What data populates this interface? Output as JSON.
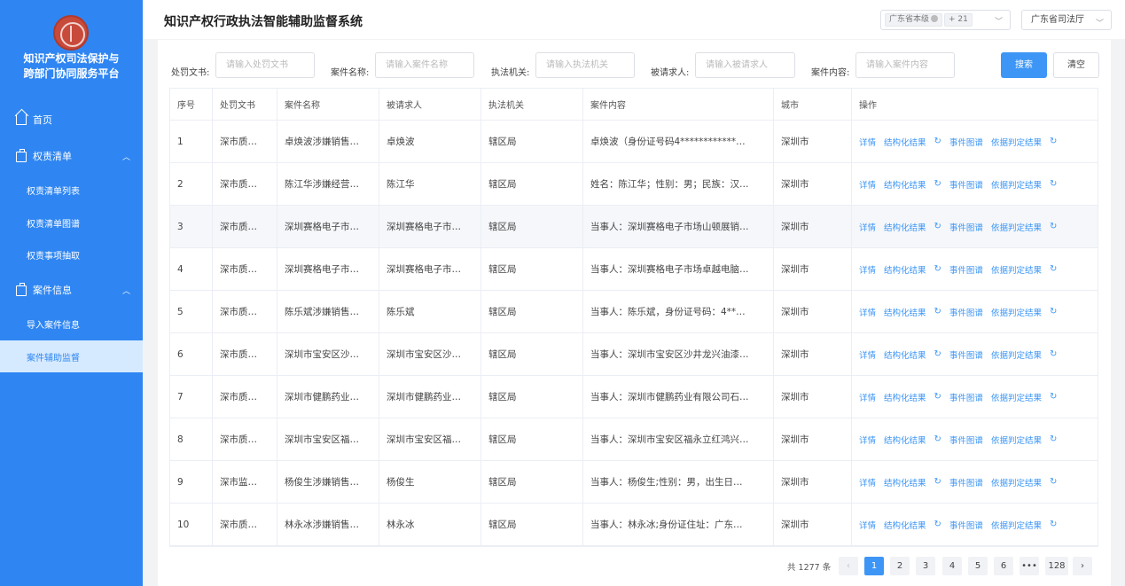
{
  "sidebar": {
    "platform_title_line1": "知识产权司法保护与",
    "platform_title_line2": "跨部门协同服务平台",
    "items": [
      {
        "label": "首页"
      },
      {
        "label": "权责清单"
      },
      {
        "label": "权责清单列表"
      },
      {
        "label": "权责清单图谱"
      },
      {
        "label": "权责事项抽取"
      },
      {
        "label": "案件信息"
      },
      {
        "label": "导入案件信息"
      },
      {
        "label": "案件辅助监督"
      }
    ]
  },
  "header": {
    "title": "知识产权行政执法智能辅助监督系统",
    "region_tag": "广东省本级",
    "region_more": "+ 21",
    "department": "广东省司法厅"
  },
  "filters": {
    "doc": {
      "label": "处罚文书:",
      "placeholder": "请输入处罚文书"
    },
    "name": {
      "label": "案件名称:",
      "placeholder": "请输入案件名称"
    },
    "agency": {
      "label": "执法机关:",
      "placeholder": "请输入执法机关"
    },
    "respondent": {
      "label": "被请求人:",
      "placeholder": "请输入被请求人"
    },
    "content": {
      "label": "案件内容:",
      "placeholder": "请输入案件内容"
    },
    "search_label": "搜索",
    "clear_label": "清空"
  },
  "table": {
    "headers": [
      "序号",
      "处罚文书",
      "案件名称",
      "被请求人",
      "执法机关",
      "案件内容",
      "城市",
      "操作"
    ],
    "ops": [
      "详情",
      "结构化结果",
      "事件图谱",
      "依据判定结果"
    ],
    "rows": [
      {
        "no": "1",
        "doc": "深市质…",
        "name": "卓焕波涉嫌销售…",
        "respondent": "卓焕波",
        "agency": "辖区局",
        "content": "卓焕波（身份证号码4************…",
        "city": "深圳市"
      },
      {
        "no": "2",
        "doc": "深市质…",
        "name": "陈江华涉嫌经营…",
        "respondent": "陈江华",
        "agency": "辖区局",
        "content": "姓名：陈江华；性别：男；民族：汉…",
        "city": "深圳市"
      },
      {
        "no": "3",
        "doc": "深市质…",
        "name": "深圳赛格电子市…",
        "respondent": "深圳赛格电子市…",
        "agency": "辖区局",
        "content": "当事人：深圳赛格电子市场山顿展销…",
        "city": "深圳市"
      },
      {
        "no": "4",
        "doc": "深市质…",
        "name": "深圳赛格电子市…",
        "respondent": "深圳赛格电子市…",
        "agency": "辖区局",
        "content": "当事人：深圳赛格电子市场卓越电脑…",
        "city": "深圳市"
      },
      {
        "no": "5",
        "doc": "深市质…",
        "name": "陈乐斌涉嫌销售…",
        "respondent": "陈乐斌",
        "agency": "辖区局",
        "content": "当事人：陈乐斌，身份证号码：4**…",
        "city": "深圳市"
      },
      {
        "no": "6",
        "doc": "深市质…",
        "name": "深圳市宝安区沙…",
        "respondent": "深圳市宝安区沙…",
        "agency": "辖区局",
        "content": "当事人：深圳市宝安区沙井龙兴油漆…",
        "city": "深圳市"
      },
      {
        "no": "7",
        "doc": "深市质…",
        "name": "深圳市健鹏药业…",
        "respondent": "深圳市健鹏药业…",
        "agency": "辖区局",
        "content": "当事人：深圳市健鹏药业有限公司石…",
        "city": "深圳市"
      },
      {
        "no": "8",
        "doc": "深市质…",
        "name": "深圳市宝安区福…",
        "respondent": "深圳市宝安区福…",
        "agency": "辖区局",
        "content": "当事人：深圳市宝安区福永立红鸿兴…",
        "city": "深圳市"
      },
      {
        "no": "9",
        "doc": "深市监…",
        "name": "杨俊生涉嫌销售…",
        "respondent": "杨俊生",
        "agency": "辖区局",
        "content": "当事人：杨俊生;性别：男，出生日…",
        "city": "深圳市"
      },
      {
        "no": "10",
        "doc": "深市质…",
        "name": "林永冰涉嫌销售…",
        "respondent": "林永冰",
        "agency": "辖区局",
        "content": "当事人：林永冰;身份证住址：广东…",
        "city": "深圳市"
      }
    ]
  },
  "pagination": {
    "total": "共 1277 条",
    "prev": "‹",
    "next": "›",
    "pages": [
      "1",
      "2",
      "3",
      "4",
      "5",
      "6",
      "•••",
      "128"
    ],
    "current": "1"
  }
}
